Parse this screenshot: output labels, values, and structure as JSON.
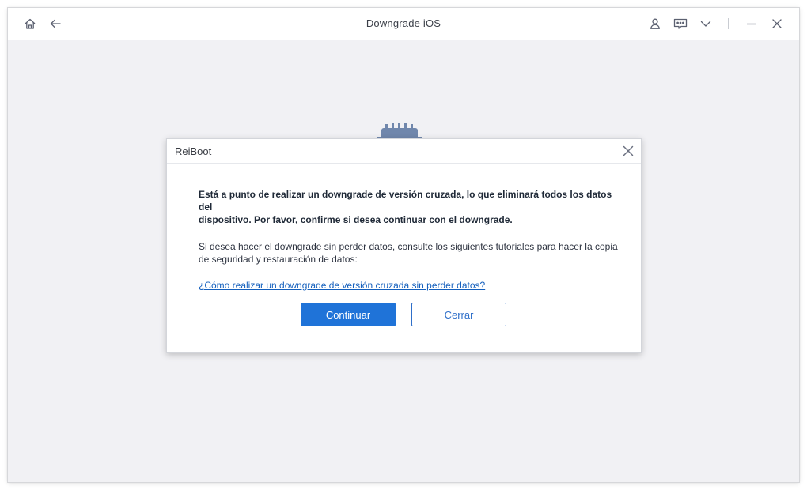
{
  "window": {
    "title": "Downgrade iOS",
    "icons": [
      "home-icon",
      "back-arrow-icon",
      "user-icon",
      "feedback-icon",
      "dropdown-chevron-icon",
      "minimize-icon",
      "close-icon"
    ]
  },
  "colors": {
    "primary": "#1f73d8",
    "link": "#1560bd",
    "background": "#f1f2f5",
    "device": "#2b4f86"
  },
  "dialog": {
    "title": "ReiBoot",
    "warning_line1": "Está a punto de realizar un downgrade de versión cruzada, lo que eliminará todos los datos del",
    "warning_line2": "dispositivo. Por favor, confirme si desea continuar con el downgrade.",
    "info_line1": "Si desea hacer el downgrade sin perder datos, consulte los siguientes tutoriales para hacer la copia",
    "info_line2": "de seguridad y restauración de datos:",
    "link_text": "¿Cómo realizar un downgrade de versión cruzada sin perder datos?",
    "confirm_label": "Continuar",
    "close_label": "Cerrar"
  }
}
